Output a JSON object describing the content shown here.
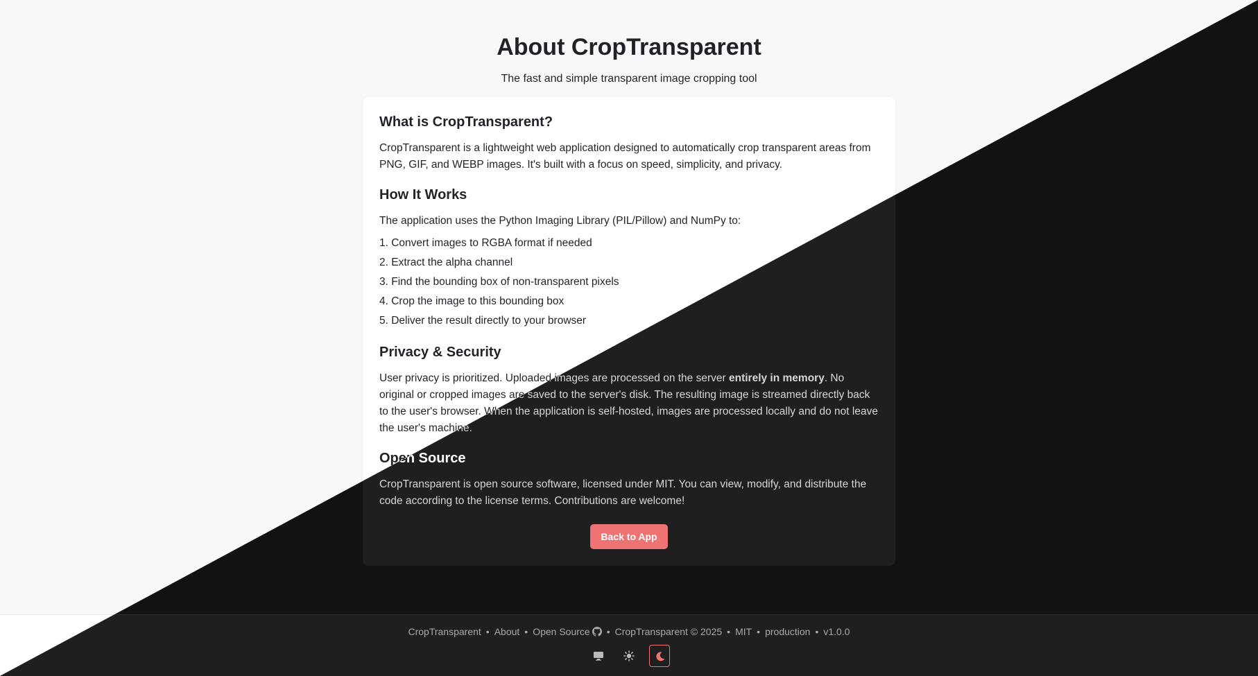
{
  "header": {
    "title": "About CropTransparent",
    "subtitle": "The fast and simple transparent image cropping tool"
  },
  "sections": {
    "what": {
      "heading": "What is CropTransparent?",
      "body": "CropTransparent is a lightweight web application designed to automatically crop transparent areas from PNG, GIF, and WEBP images. It's built with a focus on speed, simplicity, and privacy."
    },
    "how": {
      "heading": "How It Works",
      "intro": "The application uses the Python Imaging Library (PIL/Pillow) and NumPy to:",
      "steps": [
        "1. Convert images to RGBA format if needed",
        "2. Extract the alpha channel",
        "3. Find the bounding box of non-transparent pixels",
        "4. Crop the image to this bounding box",
        "5. Deliver the result directly to your browser"
      ]
    },
    "privacy": {
      "heading": "Privacy & Security",
      "before": "User privacy is prioritized. Uploaded images are processed on the server ",
      "emphasis": "entirely in memory",
      "after": ". No original or cropped images are saved to the server's disk. The resulting image is streamed directly back to the user's browser. When the application is self-hosted, images are processed locally and do not leave the user's machine."
    },
    "opensource": {
      "heading": "Open Source",
      "body": "CropTransparent is open source software, licensed under MIT. You can view, modify, and distribute the code according to the license terms. Contributions are welcome!"
    }
  },
  "back_button": "Back to App",
  "footer": {
    "links": [
      "CropTransparent",
      "About",
      "Open Source",
      "CropTransparent © 2025",
      "MIT",
      "production",
      "v1.0.0"
    ],
    "separator": "•"
  },
  "theme_buttons": [
    {
      "icon": "monitor-icon",
      "active": false
    },
    {
      "icon": "sun-icon",
      "active": false
    },
    {
      "icon": "moon-icon",
      "active": true
    }
  ],
  "colors": {
    "accent": "#f07373",
    "light_bg": "#f7f8fa",
    "dark_bg": "#121212",
    "dark_card": "#1f1f1f"
  }
}
